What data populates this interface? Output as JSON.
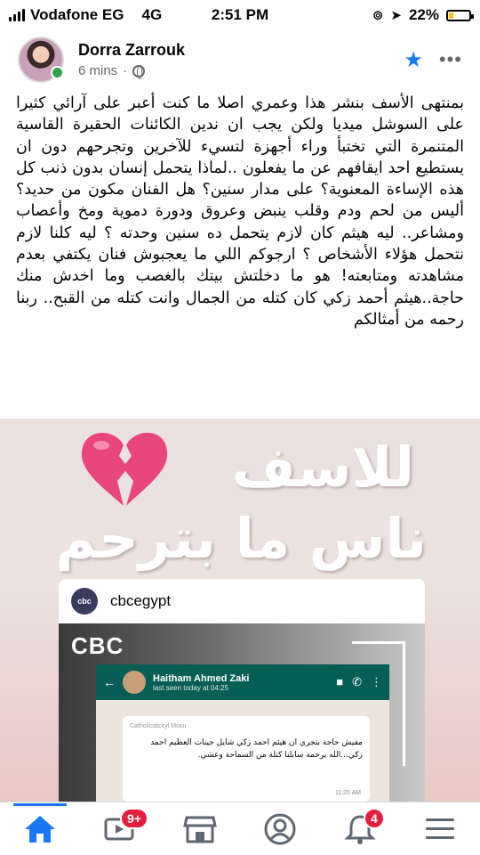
{
  "status_bar": {
    "carrier": "Vodafone EG",
    "network": "4G",
    "time": "2:51 PM",
    "battery": "22%",
    "battery_level": 0.22,
    "battery_color": "#f5c400"
  },
  "post": {
    "author": "Dorra Zarrouk",
    "time": "6 mins",
    "privacy_icon": "globe-icon",
    "text": "بمنتهى الأسف بنشر هذا وعمري اصلا ما كنت أعبر على آرائي كثيرا على السوشل ميديا ولكن يجب ان ندين الكائنات الحقيرة القاسية المتنمرة التي تختبأ وراء أجهزة لتسيء للآخرين وتجرحهم دون ان يستطيع احد ايقافهم عن ما يفعلون ..لماذا يتحمل إنسان بدون ذنب كل هذه الإساءة المعنوية؟ على مدار سنين؟ هل الفنان مكون من حديد؟ أليس من لحم ودم وقلب ينبض وعروق ودورة دموية ومخ وأعصاب ومشاعر.. ليه هيثم كان لازم يتحمل ده سنين وحدته ؟ ليه كلنا لازم نتحمل هؤلاء الأشخاص ؟ ارجوكم اللي ما يعجبوش فنان يكتفي بعدم مشاهدته ومتابعته! هو ما دخلتش بيتك بالغصب وما اخدش منك حاجة..هيثم أحمد زكي كان كتله من الجمال وانت كتله من القبح.. ربنا رحمه من أمثالكم"
  },
  "shared_image": {
    "line1": "للاسف",
    "line2": "ناس ما بترحم",
    "card_account": "cbcegypt",
    "card_logo": "cbc",
    "watermark": "CBC",
    "chat_name": "Haitham Ahmed Zaki",
    "chat_status": "last seen today at 04:25",
    "chat_sender": "Catholicstickyl Mosu",
    "chat_message": "مفيش حاجة بتجري ان هيثم احمد زكي شايل جينات العظيم احمد زكي...الله يرحمه سابلنا كتلة من السماحة وعشي.",
    "chat_time": "11:20 AM"
  },
  "tab_bar": {
    "active_color": "#1877f2",
    "badge_color": "#e41e3f",
    "tabs": [
      {
        "name": "home-icon",
        "badge": ""
      },
      {
        "name": "watch-icon",
        "badge": "9+"
      },
      {
        "name": "marketplace-icon",
        "badge": ""
      },
      {
        "name": "profile-icon",
        "badge": ""
      },
      {
        "name": "notifications-icon",
        "badge": "4"
      },
      {
        "name": "menu-icon",
        "badge": ""
      }
    ]
  }
}
